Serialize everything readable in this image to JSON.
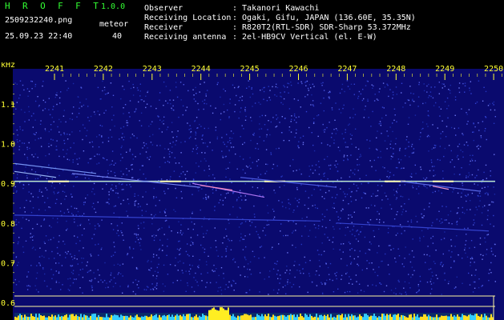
{
  "header": {
    "app_name": "H R O F F T",
    "app_version": "1.0.0",
    "file_name": "2509232240.png",
    "datetime": "25.09.23 22:40",
    "meteor_label": "meteor",
    "meteor_count": "40",
    "info": [
      {
        "label": "Observer",
        "value": ": Takanori Kawachi"
      },
      {
        "label": "Receiving Location",
        "value": ": Ogaki, Gifu, JAPAN (136.60E, 35.35N)"
      },
      {
        "label": "Receiver",
        "value": ": R820T2(RTL-SDR) SDR-Sharp 53.372MHz"
      },
      {
        "label": "Receiving antenna",
        "value": ": 2el-HB9CV Vertical (el. E-W)"
      }
    ]
  },
  "spectrogram": {
    "y_unit": "kHz",
    "y_ticks": [
      "1.1",
      "1.0",
      "0.9",
      "0.8",
      "0.7",
      "0.6"
    ],
    "time_ticks": [
      "2241",
      "2242",
      "2243",
      "2244",
      "2245",
      "2246",
      "2247",
      "2248",
      "2249",
      "2250"
    ],
    "colors": {
      "background": "#0a0a6e",
      "text_yellow": "#ffff33",
      "carrier": "#e8ffb0",
      "baseline": "#33ccff"
    }
  }
}
